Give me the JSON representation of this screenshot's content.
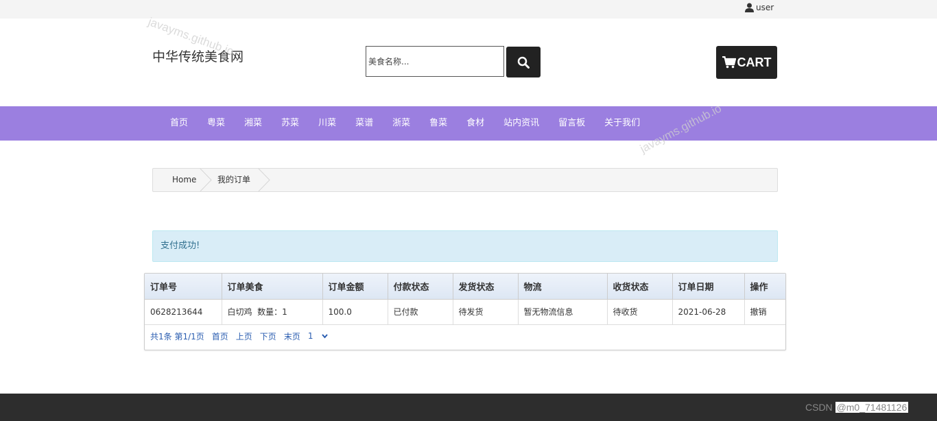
{
  "topbar": {
    "user_label": "user"
  },
  "header": {
    "site_title": "中华传统美食网",
    "search_placeholder": "美食名称...",
    "cart_label": "CART"
  },
  "nav": {
    "items": [
      "首页",
      "粤菜",
      "湘菜",
      "苏菜",
      "川菜",
      "菜谱",
      "浙菜",
      "鲁菜",
      "食材",
      "站内资讯",
      "留言板",
      "关于我们"
    ]
  },
  "breadcrumb": {
    "home": "Home",
    "current": "我的订单"
  },
  "alert": {
    "message": "支付成功!"
  },
  "orders": {
    "headers": [
      "订单号",
      "订单美食",
      "订单金额",
      "付款状态",
      "发货状态",
      "物流",
      "收货状态",
      "订单日期",
      "操作"
    ],
    "rows": [
      {
        "order_no": "0628213644",
        "food": "白切鸡  数量：1",
        "amount": "100.0",
        "pay_status": "已付款",
        "ship_status": "待发货",
        "logistics": "暂无物流信息",
        "receive_status": "待收货",
        "date": "2021-06-28",
        "action": "撤销"
      }
    ]
  },
  "pager": {
    "info": "共1条 第1/1页",
    "first": "首页",
    "prev": "上页",
    "next": "下页",
    "last": "末页",
    "page_value": "1"
  },
  "watermarks": {
    "text": "javayms.github.io"
  },
  "csdn": {
    "brand": "CSDN",
    "handle": "@m0_71481126"
  },
  "colors": {
    "nav_bg": "#9b7fe0",
    "dark_button": "#222222",
    "alert_bg": "#d9edf7",
    "alert_text": "#31708f",
    "footer_bg": "#2d2d2d"
  },
  "icons": {
    "user": "user-icon",
    "search": "search-icon",
    "cart": "cart-icon",
    "dropdown": "chevron-down-icon"
  }
}
